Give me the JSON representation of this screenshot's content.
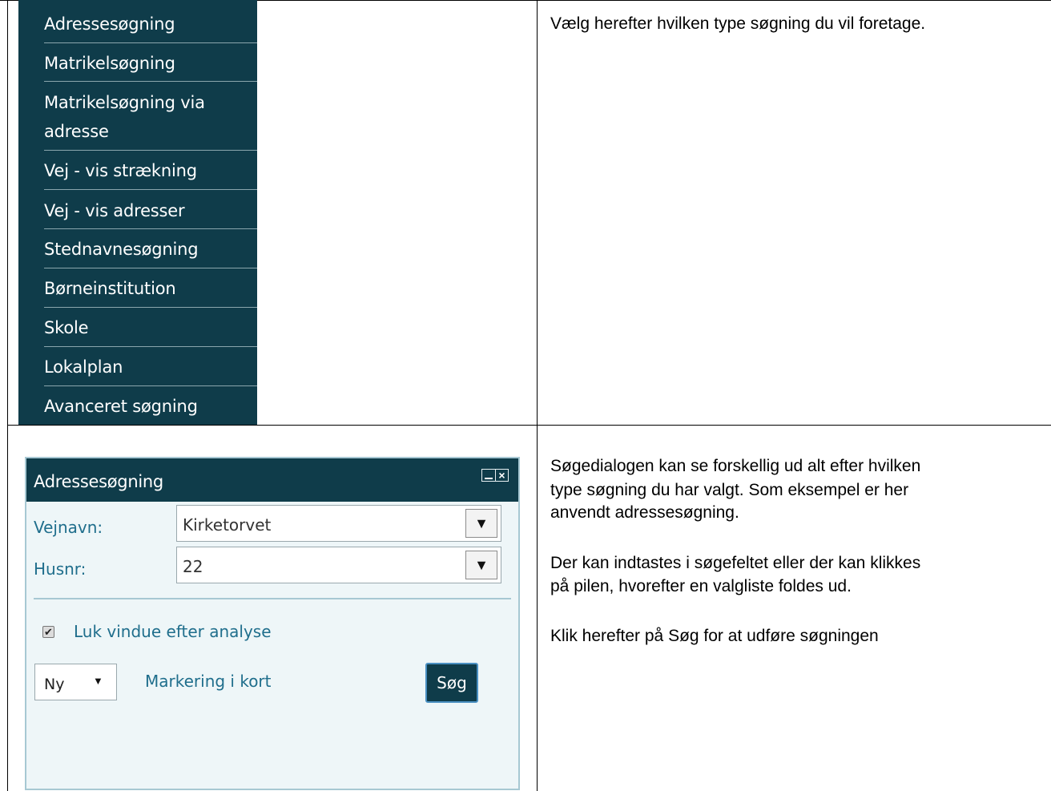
{
  "menu": {
    "items": [
      "Adressesøgning",
      "Matrikelsøgning",
      "Matrikelsøgning via adresse",
      "Vej - vis strækning",
      "Vej - vis adresser",
      "Stednavnesøgning",
      "Børneinstitution",
      "Skole",
      "Lokalplan",
      "Avanceret søgning"
    ],
    "item_3_line1": "Matrikelsøgning via",
    "item_3_line2": "adresse"
  },
  "instructions": {
    "top": "Vælg herefter hvilken type søgning du vil foretage.",
    "p1_l1": "Søgedialogen kan se forskellig ud alt efter hvilken",
    "p1_l2": "type søgning du har valgt. Som eksempel er her",
    "p1_l3": "anvendt adressesøgning.",
    "p2_l1": "Der kan indtastes i søgefeltet eller der kan klikkes",
    "p2_l2": "på pilen, hvorefter en valgliste foldes ud.",
    "p3": "Klik herefter på Søg for at udføre søgningen"
  },
  "dialog": {
    "title": "Adressesøgning",
    "vejnavn_label": "Vejnavn:",
    "vejnavn_value": "Kirketorvet",
    "husnr_label": "Husnr:",
    "husnr_value": "22",
    "close_after_label": "Luk vindue efter analyse",
    "close_after_checked": true,
    "mode_value": "Ny",
    "marking_label": "Markering i kort",
    "search_label": "Søg"
  },
  "icons": {
    "dropdown": "triangle-down-icon",
    "window_controls": "minimize-close-icon",
    "check": "checkmark-icon"
  }
}
